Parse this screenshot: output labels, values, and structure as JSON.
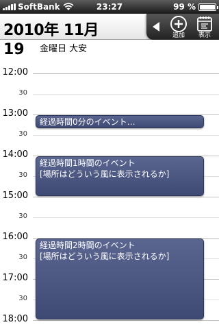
{
  "status_bar": {
    "carrier": "SoftBank",
    "time": "23:27",
    "battery": "99 %",
    "battery_level": 0.99
  },
  "header": {
    "month_title": "2010年 11月",
    "add_label": "追加",
    "view_label": "表示"
  },
  "day": {
    "number": "19",
    "info": "金曜日 大安"
  },
  "timeline": {
    "ticks": [
      {
        "label": "12:00",
        "kind": "hour"
      },
      {
        "label": "30",
        "kind": "half"
      },
      {
        "label": "13:00",
        "kind": "hour"
      },
      {
        "label": "30",
        "kind": "half"
      },
      {
        "label": "14:00",
        "kind": "hour"
      },
      {
        "label": "30",
        "kind": "half"
      },
      {
        "label": "15:00",
        "kind": "hour"
      },
      {
        "label": "30",
        "kind": "half"
      },
      {
        "label": "16:00",
        "kind": "hour"
      },
      {
        "label": "30",
        "kind": "half"
      },
      {
        "label": "17:00",
        "kind": "hour"
      },
      {
        "label": "30",
        "kind": "half"
      },
      {
        "label": "18:00",
        "kind": "hour"
      }
    ]
  },
  "events": [
    {
      "title": "経過時間0分のイベント…",
      "location": "",
      "start": "13:00",
      "end": "13:00"
    },
    {
      "title": "経過時間1時間のイベント",
      "location": "[場所はどういう風に表示されるか]",
      "start": "14:00",
      "end": "15:00"
    },
    {
      "title": "経過時間2時間のイベント",
      "location": "[場所はどういう風に表示されるか]",
      "start": "16:00",
      "end": "18:00"
    }
  ]
}
